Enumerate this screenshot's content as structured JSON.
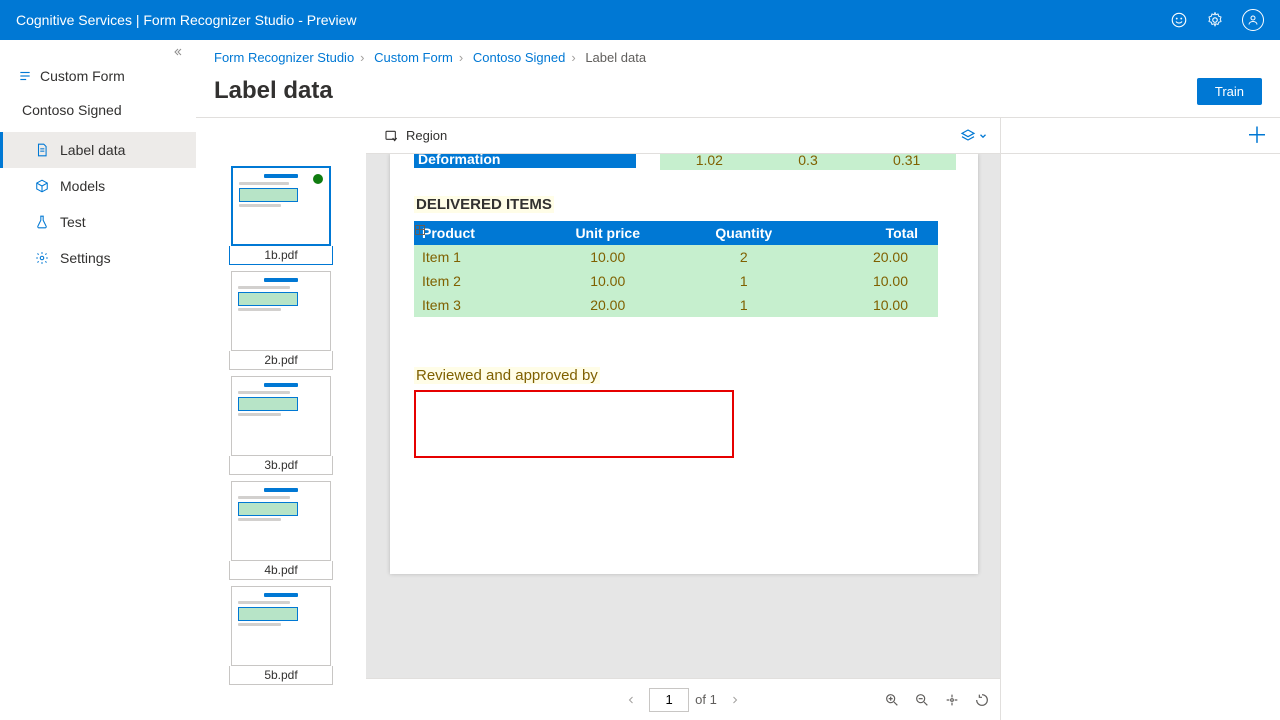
{
  "topbar": {
    "title": "Cognitive Services | Form Recognizer Studio - Preview"
  },
  "sidebar": {
    "category": "Custom Form",
    "project": "Contoso Signed",
    "items": [
      {
        "label": "Label data"
      },
      {
        "label": "Models"
      },
      {
        "label": "Test"
      },
      {
        "label": "Settings"
      }
    ]
  },
  "breadcrumb": {
    "items": [
      "Form Recognizer Studio",
      "Custom Form",
      "Contoso Signed"
    ],
    "current": "Label data"
  },
  "page": {
    "title": "Label data",
    "train_button": "Train"
  },
  "toolbar": {
    "region": "Region"
  },
  "thumbnails": [
    {
      "label": "1b.pdf",
      "status": "done",
      "selected": true
    },
    {
      "label": "2b.pdf"
    },
    {
      "label": "3b.pdf"
    },
    {
      "label": "4b.pdf"
    },
    {
      "label": "5b.pdf"
    }
  ],
  "doc": {
    "clip_row": {
      "label": "Deformation",
      "v1": "1.02",
      "v2": "0.3",
      "v3": "0.31"
    },
    "section": "DELIVERED ITEMS",
    "table": {
      "headers": [
        "Product",
        "Unit price",
        "Quantity",
        "Total"
      ],
      "rows": [
        [
          "Item 1",
          "10.00",
          "2",
          "20.00"
        ],
        [
          "Item 2",
          "10.00",
          "1",
          "10.00"
        ],
        [
          "Item 3",
          "20.00",
          "1",
          "10.00"
        ]
      ]
    },
    "approved": "Reviewed and approved by"
  },
  "pager": {
    "page": "1",
    "of": "of 1"
  }
}
